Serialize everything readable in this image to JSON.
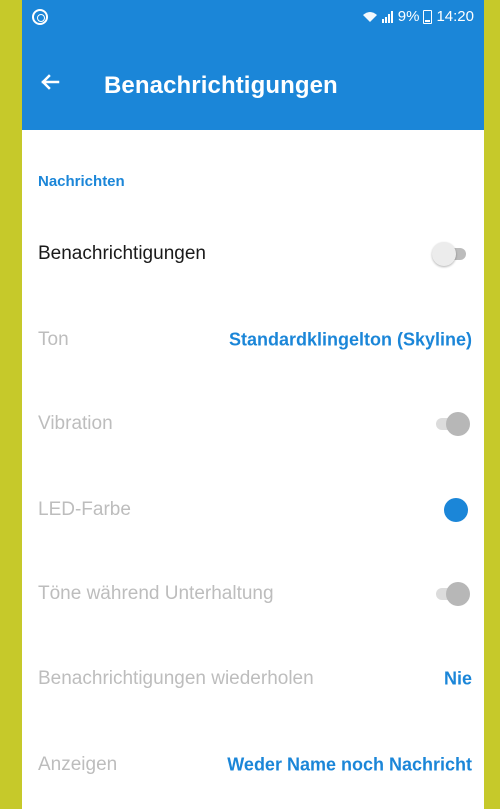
{
  "status_bar": {
    "signal_text": "9%",
    "time": "14:20",
    "left_icon": "data-saver-icon",
    "icons": [
      "wifi-icon",
      "signal-icon",
      "battery-icon"
    ]
  },
  "app_bar": {
    "back_icon": "back-arrow-icon",
    "title": "Benachrichtigungen"
  },
  "section": {
    "title": "Nachrichten"
  },
  "rows": [
    {
      "label": "Benachrichtigungen",
      "control": "switch",
      "state": "off",
      "enabled": true
    },
    {
      "label": "Ton",
      "value": "Standardklingelton (Skyline)",
      "enabled": false
    },
    {
      "label": "Vibration",
      "control": "switch",
      "state": "on",
      "enabled": false
    },
    {
      "label": "LED-Farbe",
      "control": "color",
      "color": "#1b86d8",
      "enabled": false
    },
    {
      "label": "Töne während Unterhaltung",
      "control": "switch",
      "state": "on",
      "enabled": false
    },
    {
      "label": "Benachrichtigungen wiederholen",
      "value": "Nie",
      "enabled": false
    },
    {
      "label": "Anzeigen",
      "value": "Weder Name noch Nachricht",
      "enabled": false
    }
  ],
  "colors": {
    "accent": "#1b86d8",
    "frame_background": "#c6c92a",
    "disabled_text": "#bdbdbd"
  }
}
